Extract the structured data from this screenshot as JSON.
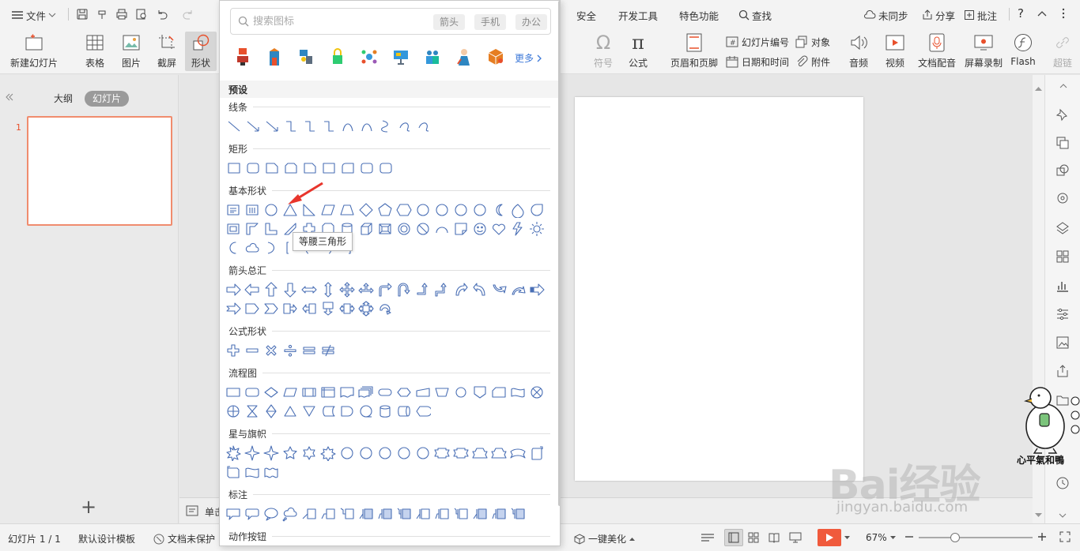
{
  "menubar": {
    "menu_label": "文件",
    "tabs": [
      "安全",
      "开发工具",
      "特色功能"
    ],
    "search_label": "查找",
    "sync_label": "未同步",
    "share_label": "分享",
    "comment_label": "批注",
    "help_label": "?"
  },
  "ribbon": {
    "new_slide": "新建幻灯片",
    "table": "表格",
    "picture": "图片",
    "screenshot": "截屏",
    "shape": "形状",
    "symbol": "符号",
    "formula": "公式",
    "header_footer": "页眉和页脚",
    "slide_number": "幻灯片编号",
    "object": "对象",
    "datetime": "日期和时间",
    "attachment": "附件",
    "audio": "音频",
    "video": "视频",
    "doc_voice": "文档配音",
    "screen_record": "屏幕录制",
    "flash": "Flash",
    "hyperlink": "超链"
  },
  "left_panel": {
    "tab_outline": "大纲",
    "tab_slides": "幻灯片",
    "slide_number": "1",
    "add_label": "+"
  },
  "notes_label": "单击",
  "statusbar": {
    "slide_info": "幻灯片 1 / 1",
    "template": "默认设计模板",
    "protect": "文档未保护",
    "beautify": "一键美化",
    "zoom": "67%"
  },
  "shapes_panel": {
    "search_placeholder": "搜索图标",
    "tags": [
      "箭头",
      "手机",
      "办公"
    ],
    "more_label": "更多",
    "preset_label": "预设",
    "categories": {
      "lines": "线条",
      "rectangles": "矩形",
      "basic": "基本形状",
      "arrows": "箭头总汇",
      "equation": "公式形状",
      "flowchart": "流程图",
      "stars": "星与旗帜",
      "callouts": "标注",
      "action": "动作按钮"
    },
    "tooltip": "等腰三角形"
  },
  "watermark": {
    "big": "Bai经验",
    "small": "jingyan.baidu.com",
    "sticker_text": "心平氣和鴨"
  },
  "colors": {
    "accent_orange": "#e8502c",
    "shape_stroke": "#4a6fb5",
    "link_blue": "#3c78d8",
    "play_red": "#f05a3c"
  }
}
